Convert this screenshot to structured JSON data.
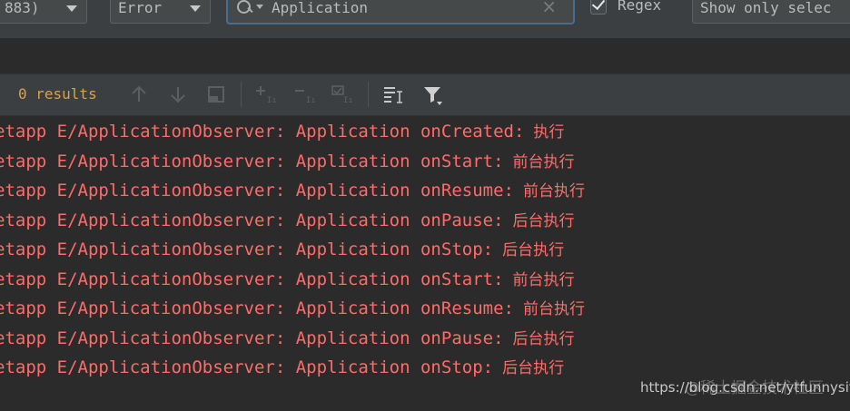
{
  "filter_bar": {
    "process_value": "883)",
    "level_value": "Error",
    "search_value": "Application",
    "clear_symbol": "×",
    "regex_checked": true,
    "regex_label": "Regex",
    "show_only_value": "Show only selec"
  },
  "toolbar": {
    "results_count": "0 results"
  },
  "log_lines": [
    {
      "text": "etapp E/ApplicationObserver: Application onCreated:",
      "cjk": "执行"
    },
    {
      "text": "etapp E/ApplicationObserver: Application onStart:",
      "cjk": "前台执行"
    },
    {
      "text": "etapp E/ApplicationObserver: Application onResume:",
      "cjk": "前台执行"
    },
    {
      "text": "etapp E/ApplicationObserver: Application onPause:",
      "cjk": "后台执行"
    },
    {
      "text": "etapp E/ApplicationObserver: Application onStop:",
      "cjk": "后台执行"
    },
    {
      "text": "etapp E/ApplicationObserver: Application onStart:",
      "cjk": "前台执行"
    },
    {
      "text": "etapp E/ApplicationObserver: Application onResume:",
      "cjk": "前台执行"
    },
    {
      "text": "etapp E/ApplicationObserver: Application onPause:",
      "cjk": "后台执行"
    },
    {
      "text": "etapp E/ApplicationObserver: Application onStop:",
      "cjk": "后台执行"
    }
  ],
  "watermark": {
    "site_name": "@稀土掘金技术社区",
    "url": "https://blog.csdn.net/ytfunnysite"
  },
  "colors": {
    "error_text": "#ff6b68",
    "results_text": "#d9a149",
    "focus_border": "#466d94"
  }
}
